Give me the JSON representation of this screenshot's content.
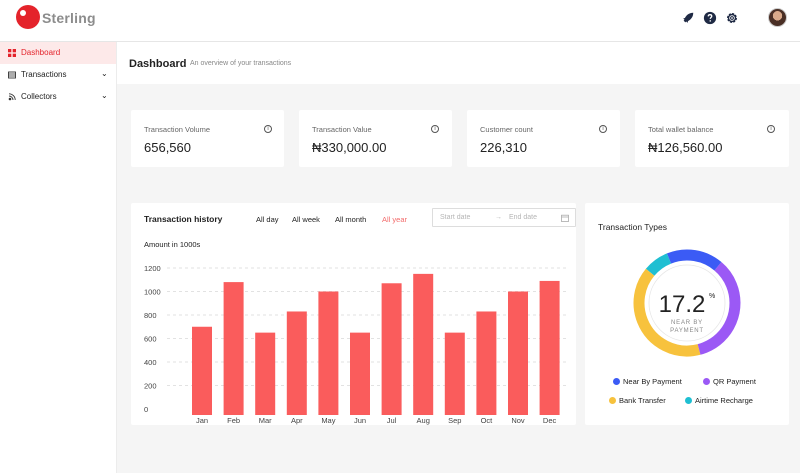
{
  "header": {
    "brand": "Sterling",
    "icons": [
      "rocket-icon",
      "help-icon",
      "gear-icon",
      "avatar"
    ]
  },
  "sidebar": {
    "items": [
      {
        "label": "Dashboard",
        "icon": "grid-icon",
        "active": true
      },
      {
        "label": "Transactions",
        "icon": "table-icon",
        "expandable": true
      },
      {
        "label": "Collectors",
        "icon": "collectors-icon",
        "expandable": true
      }
    ]
  },
  "page": {
    "title": "Dashboard",
    "subtitle": "An overview of your transactions"
  },
  "stats": [
    {
      "label": "Transaction Volume",
      "value": "656,560"
    },
    {
      "label": "Transaction Value",
      "value": "₦330,000.00"
    },
    {
      "label": "Customer count",
      "value": "226,310"
    },
    {
      "label": "Total wallet balance",
      "value": "₦126,560.00"
    }
  ],
  "history": {
    "title": "Transaction history",
    "filters": [
      "All day",
      "All week",
      "All month",
      "All year"
    ],
    "active_filter": "All year",
    "start_placeholder": "Start date",
    "end_placeholder": "End date",
    "arrow": "→",
    "amount_label": "Amount in 1000s"
  },
  "chart_data": {
    "type": "bar",
    "categories": [
      "Jan",
      "Feb",
      "Mar",
      "Apr",
      "May",
      "Jun",
      "Jul",
      "Aug",
      "Sep",
      "Oct",
      "Nov",
      "Dec"
    ],
    "values": [
      700,
      1080,
      650,
      830,
      1000,
      650,
      1070,
      1150,
      650,
      830,
      1000,
      1090
    ],
    "ylabel": "Amount in 1000s",
    "yticks": [
      0,
      200,
      400,
      600,
      800,
      1000,
      1200
    ],
    "ylim": [
      0,
      1200
    ],
    "grid": true,
    "bar_color": "#fa5c5c"
  },
  "types": {
    "title": "Transaction Types",
    "center_value": "17.2",
    "center_unit": "%",
    "center_line1": "NEAR BY",
    "center_line2": "PAYMENT",
    "segments": [
      {
        "label": "Near By Payment",
        "share": 17.2,
        "color": "#3b5bf5"
      },
      {
        "label": "QR Payment",
        "share": 34.8,
        "color": "#9b59f5"
      },
      {
        "label": "Bank Transfer",
        "share": 40,
        "color": "#f7c23d"
      },
      {
        "label": "Airtime Recharge",
        "share": 8,
        "color": "#1fbfd2"
      }
    ]
  },
  "colors": {
    "accent": "#e4232b",
    "active_filter": "#f36b6b",
    "active_bg": "#fde9e9"
  }
}
